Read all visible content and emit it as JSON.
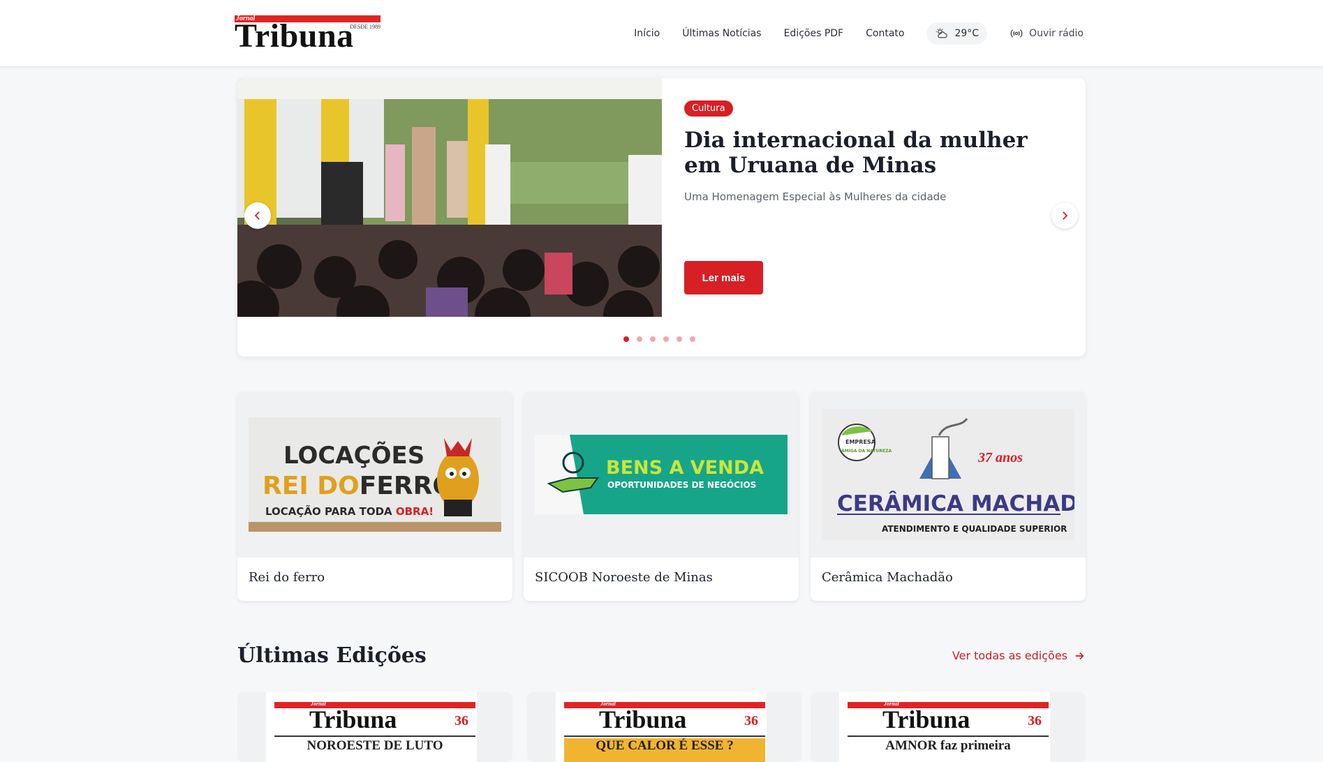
{
  "header": {
    "logo": {
      "small_text": "Jornal",
      "word": "Tribuna",
      "since": "DESDE 1989"
    },
    "nav": [
      "Início",
      "Últimas Notícias",
      "Edições PDF",
      "Contato"
    ],
    "weather": {
      "icon": "partly-cloudy-icon",
      "temperature": "29°C"
    },
    "radio": {
      "icon": "radio-broadcast-icon",
      "label": "Ouvir rádio"
    }
  },
  "hero": {
    "category": "Cultura",
    "title": "Dia internacional da mulher em Uruana de Minas",
    "subtitle": "Uma Homenagem Especial às Mulheres da cidade",
    "cta": "Ler mais",
    "slide_count": 6,
    "active_slide": 1
  },
  "sponsors": [
    {
      "name": "Rei do ferro",
      "ad": {
        "line1": "LOCAÇÕES",
        "line2a": "REI DO",
        "line2b": "FERRO",
        "line3a": "LOCAÇÃO PARA TODA ",
        "line3b": "OBRA!"
      }
    },
    {
      "name": "SICOOB Noroeste de Minas",
      "ad": {
        "line1": "BENS A VENDA",
        "line2": "OPORTUNIDADES DE NEGÓCIOS"
      }
    },
    {
      "name": "Cerâmica Machadão",
      "ad": {
        "badge1": "EMPRESA",
        "badge2": "AMIGA DA NATUREZA",
        "years": "37 anos",
        "line1": "CERÂMICA MACHADÃO",
        "line2": "ATENDIMENTO E QUALIDADE SUPERIOR"
      }
    }
  ],
  "editions": {
    "title": "Últimas Edições",
    "link": "Ver todas as edições",
    "items": [
      {
        "masthead": "Tribuna",
        "small": "Jornal",
        "anniv": "36",
        "headline": "NOROESTE DE LUTO"
      },
      {
        "masthead": "Tribuna",
        "small": "Jornal",
        "anniv": "36",
        "headline": "QUE CALOR É ESSE ?"
      },
      {
        "masthead": "Tribuna",
        "small": "Jornal",
        "anniv": "36",
        "headline": "AMNOR faz primeira"
      }
    ]
  },
  "colors": {
    "accent": "#d71f26",
    "background": "#f6f7f9"
  }
}
